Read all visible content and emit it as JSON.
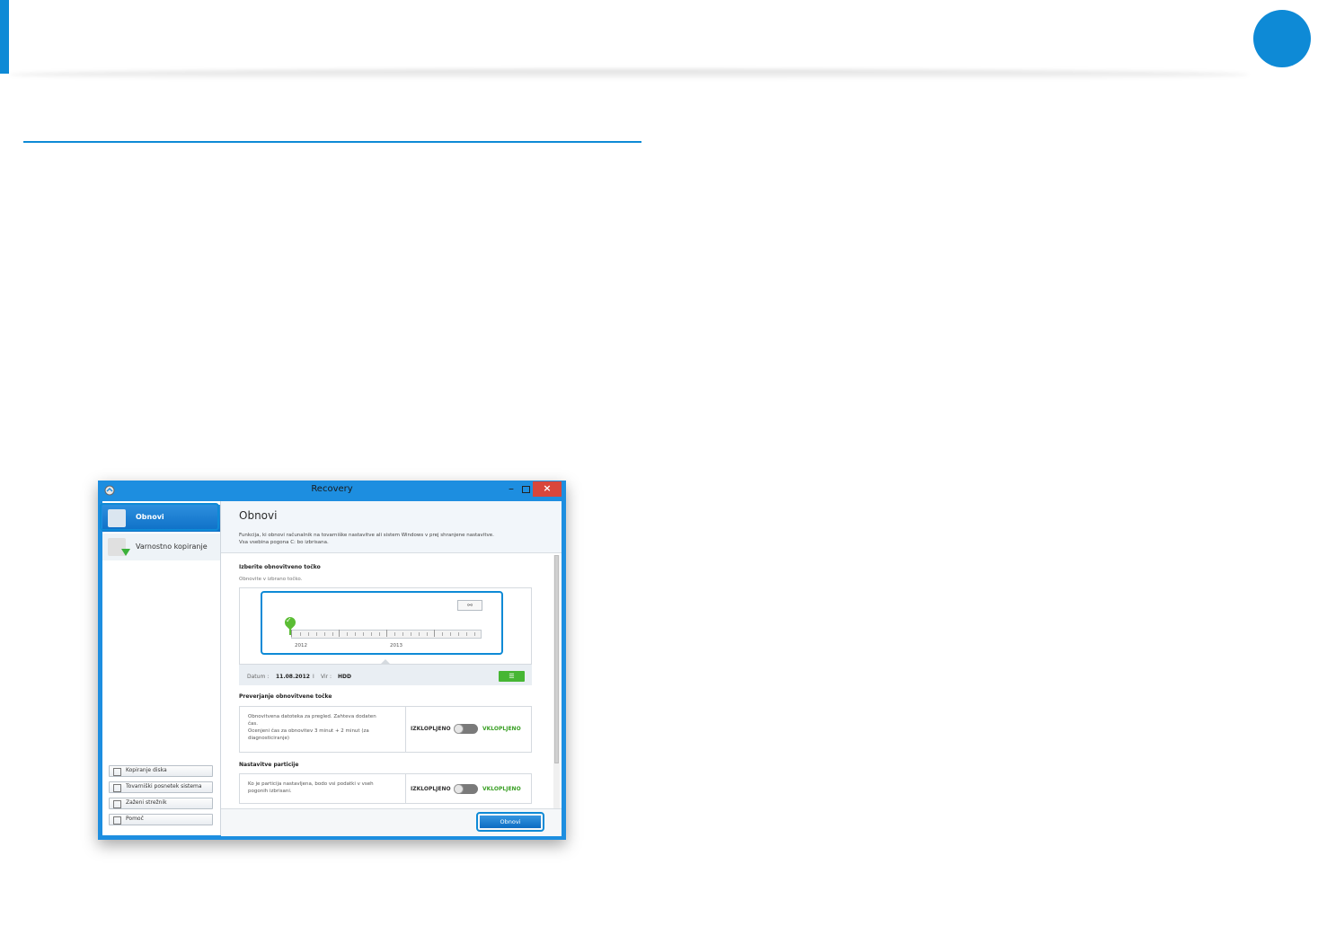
{
  "window": {
    "title": "Recovery",
    "minimize": "–",
    "close": "×"
  },
  "sidebar": {
    "items": [
      {
        "label": "Obnovi"
      },
      {
        "label": "Varnostno kopiranje"
      }
    ],
    "buttons": [
      {
        "label": "Kopiranje diska"
      },
      {
        "label": "Tovarniški posnetek sistema"
      },
      {
        "label": "Zaženi strežnik"
      },
      {
        "label": "Pomoč"
      }
    ]
  },
  "main": {
    "title": "Obnovi",
    "desc_line1": "Funkcija, ki obnovi računalnik na tovarniške nastavitve ali sistem Windows v prej shranjene nastavitve.",
    "desc_line2": "Vsa vsebina pogona C: bo izbrisana.",
    "select_heading": "Izberite obnovitveno točko",
    "select_sub": "Obnovite v izbrano točko.",
    "timeline": {
      "years": [
        "2012",
        "2013"
      ]
    },
    "info": {
      "date_label": "Datum :",
      "date_value": "11.08.2012",
      "separator": "I",
      "source_label": "Vir :",
      "source_value": "HDD"
    },
    "verify": {
      "heading": "Preverjanje obnovitvene točke",
      "text_line1": "Obnovitvena datoteka za pregled. Zahteva dodaten",
      "text_line2": "čas.",
      "text_line3": "Ocenjeni čas za obnovitev 3 minut + 2 minut (za",
      "text_line4": "diagnosticiranje)",
      "off_label": "IZKLOPLJENO",
      "on_label": "VKLOPLJENO"
    },
    "partitions": {
      "heading": "Nastavitve particije",
      "text_line1": "Ko je particija nastavljena, bodo vsi podatki v vseh",
      "text_line2": "pogonih izbrisani.",
      "off_label": "IZKLOPLJENO",
      "on_label": "VKLOPLJENO"
    },
    "restore_button": "Obnovi"
  },
  "colors": {
    "accent": "#0e8ad6",
    "active_item": "#0d6fc6",
    "toggle_on_text": "#3a9f25",
    "close_button": "#d9463b"
  },
  "icons": [
    "app-icon",
    "restore-icon",
    "backup-icon",
    "search-icon",
    "checkmark-marker-icon",
    "magnifier-icon"
  ]
}
